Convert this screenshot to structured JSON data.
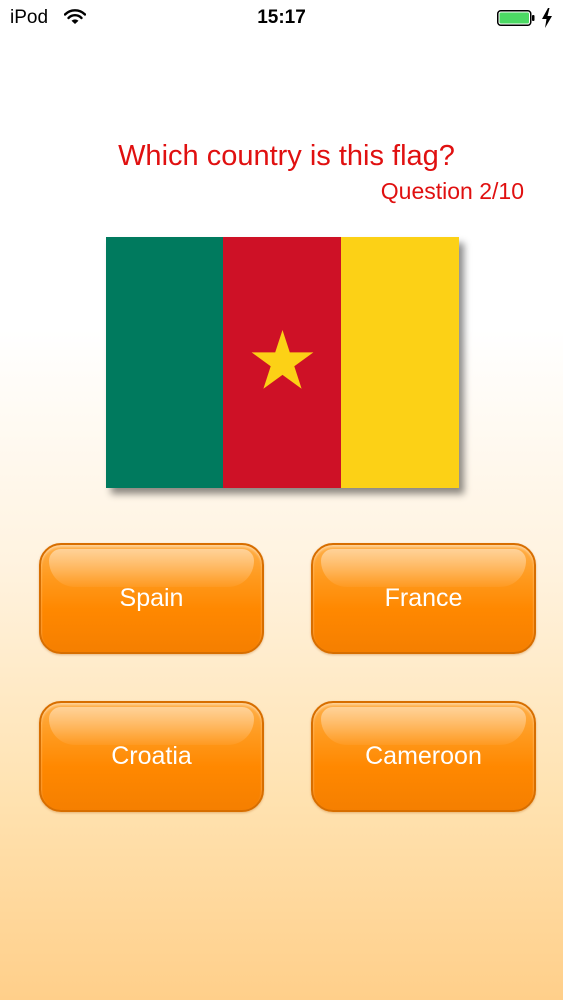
{
  "status_bar": {
    "carrier": "iPod",
    "time": "15:17",
    "icons": [
      "wifi-icon",
      "battery-icon",
      "charging-bolt-icon"
    ],
    "battery_color": "#4cd964"
  },
  "quiz": {
    "question": "Which country is this flag?",
    "counter": "Question 2/10",
    "text_color": "#e01010",
    "flag": {
      "country_shown": "Cameroon",
      "colors": {
        "green": "#007a5e",
        "red": "#ce1126",
        "yellow": "#fcd116",
        "star": "#fcd116"
      }
    },
    "answers": [
      {
        "label": "Spain"
      },
      {
        "label": "France"
      },
      {
        "label": "Croatia"
      },
      {
        "label": "Cameroon"
      }
    ],
    "button_color": "#ff8c00"
  }
}
